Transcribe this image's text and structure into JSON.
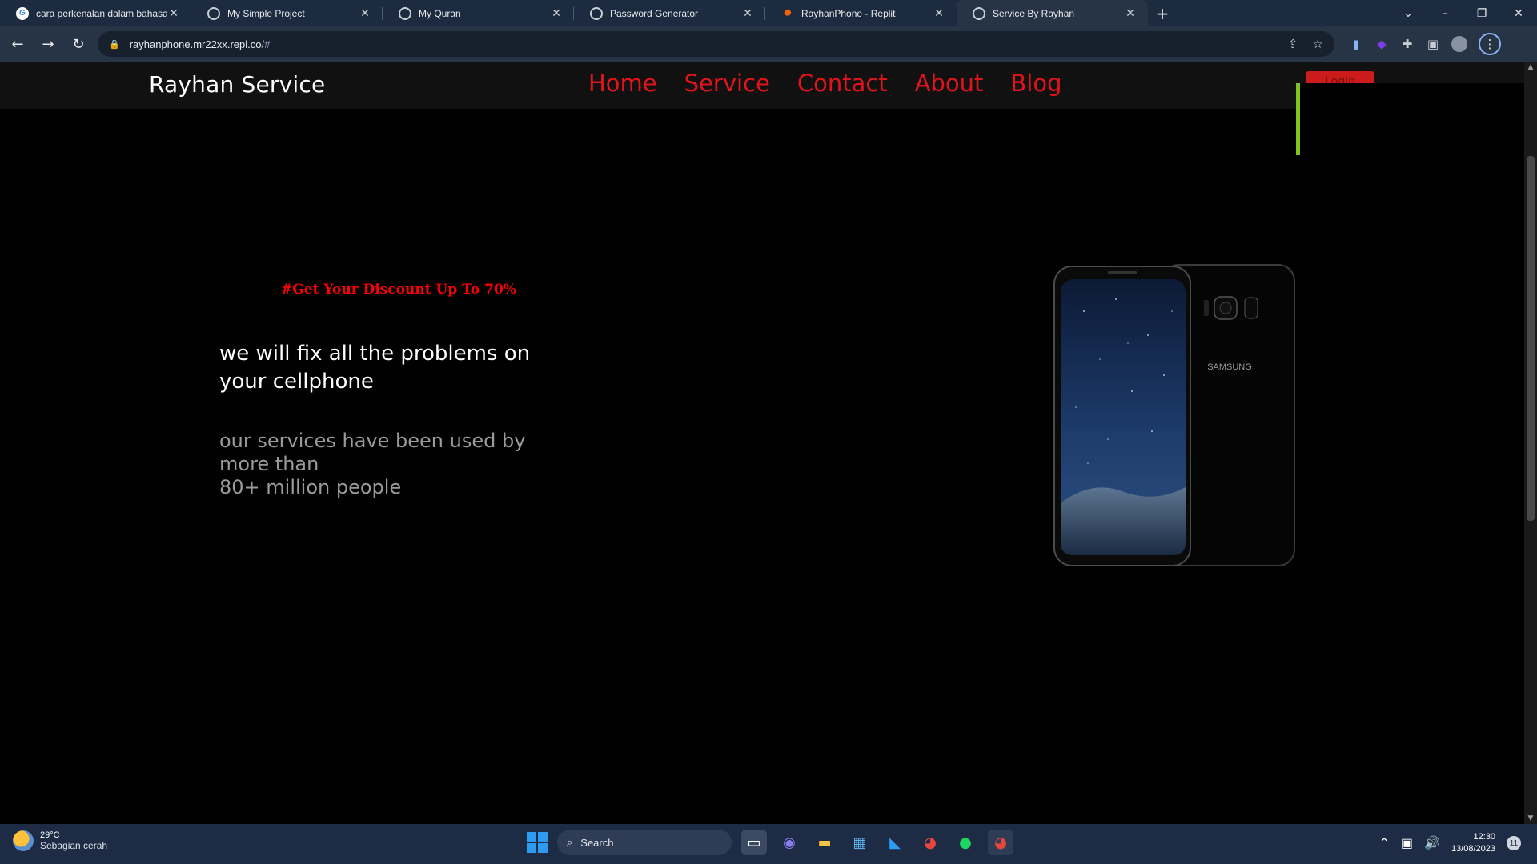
{
  "browser": {
    "tabs": [
      {
        "title": "cara perkenalan dalam bahasa in",
        "icon": "google-icon",
        "active": false
      },
      {
        "title": "My Simple Project",
        "icon": "globe-icon",
        "active": false
      },
      {
        "title": "My Quran",
        "icon": "globe-icon",
        "active": false
      },
      {
        "title": "Password Generator",
        "icon": "globe-icon",
        "active": false
      },
      {
        "title": "RayhanPhone - Replit",
        "icon": "replit-icon",
        "active": false
      },
      {
        "title": "Service By Rayhan",
        "icon": "globe-icon",
        "active": true
      }
    ],
    "url_host": "rayhanphone.mr22xx.repl.co",
    "url_path": "/#"
  },
  "site": {
    "brand": "Rayhan Service",
    "nav": [
      "Home",
      "Service",
      "Contact",
      "About",
      "Blog"
    ],
    "login_label": "Login",
    "promo": "#Get Your Discount Up To 70%",
    "headline": "we will fix all the problems on your cellphone",
    "subtext_line1": "our services have been used by more than",
    "subtext_line2": "80+ million people",
    "phone_brand": "SAMSUNG",
    "accent_color": "#e0141b"
  },
  "taskbar": {
    "weather_temp": "29°C",
    "weather_desc": "Sebagian cerah",
    "search_placeholder": "Search",
    "time": "12:30",
    "date": "13/08/2023",
    "notifications": "11"
  }
}
